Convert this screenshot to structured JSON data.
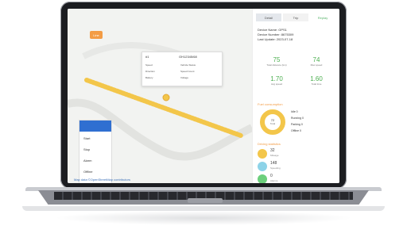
{
  "map": {
    "route_button": "Line",
    "popup": {
      "vehicle": "#1",
      "plate": "GH12345/68",
      "rows": [
        [
          "Speed",
          "Vehicle Status"
        ],
        [
          "Direction",
          "Speed Count"
        ],
        [
          "Battery",
          "Voltage"
        ]
      ]
    },
    "legend": {
      "title": "",
      "items": [
        "Start",
        "Stop",
        "Alarm",
        "Offline"
      ]
    },
    "footnote": "Map data ©OpenStreetMap contributors"
  },
  "panel": {
    "tabs": [
      "Detail",
      "Trip",
      "Replay"
    ],
    "info": [
      "Device Name: GPS1",
      "Device Number: 8675309",
      "Last Update: 2023-07-18"
    ],
    "metrics": [
      {
        "value": "75",
        "label": "Total distance (km)"
      },
      {
        "value": "74",
        "label": "Max speed"
      },
      {
        "value": "1.70",
        "label": "Avg speed"
      },
      {
        "value": "1.60",
        "label": "Total time"
      }
    ],
    "section1": "Fuel consumption",
    "section2": "Driving statistics",
    "donut": {
      "value": "72",
      "label": "Total"
    },
    "donut_legend": [
      {
        "label": "Idle",
        "value": "0"
      },
      {
        "label": "Running",
        "value": "0"
      },
      {
        "label": "Parking",
        "value": "0"
      },
      {
        "label": "Offline",
        "value": "0"
      }
    ],
    "summary": [
      {
        "value": "32",
        "label": "Mileage"
      },
      {
        "value": "148",
        "label": "Speeding"
      },
      {
        "value": "0",
        "label": "Alarms"
      }
    ],
    "colors": {
      "accent": "#f39c45",
      "green": "#4caf50",
      "blue": "#2f6fd1"
    }
  }
}
